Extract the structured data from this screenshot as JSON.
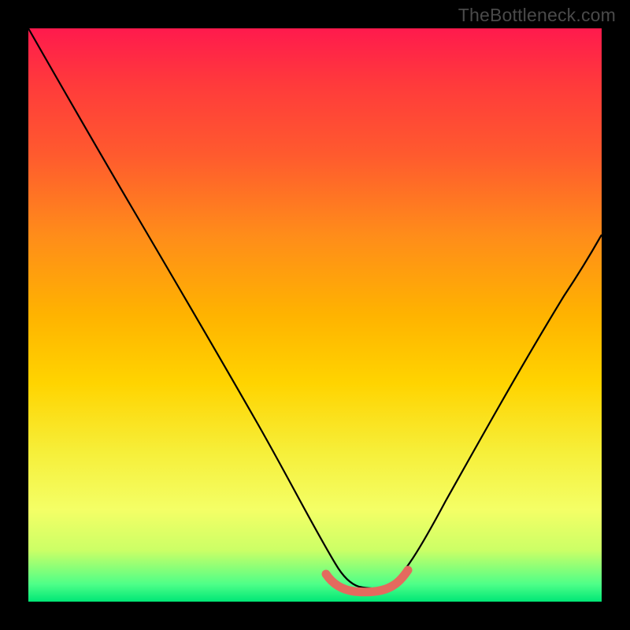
{
  "watermark": "TheBottleneck.com",
  "chart_data": {
    "type": "line",
    "title": "",
    "xlabel": "",
    "ylabel": "",
    "xlim": [
      0,
      100
    ],
    "ylim": [
      0,
      100
    ],
    "series": [
      {
        "name": "bottleneck-curve",
        "x": [
          0,
          6,
          12,
          18,
          24,
          30,
          36,
          42,
          48,
          52,
          55,
          58,
          61,
          64,
          70,
          76,
          82,
          88,
          94,
          100
        ],
        "values": [
          100,
          91,
          82,
          73,
          64,
          55,
          45,
          35,
          23,
          13,
          6,
          3,
          3,
          5,
          13,
          24,
          35,
          46,
          56,
          66
        ]
      },
      {
        "name": "sweet-spot-band",
        "x": [
          52,
          54,
          56,
          58,
          60,
          62,
          64
        ],
        "values": [
          5,
          3.5,
          2.8,
          2.5,
          2.8,
          3.5,
          5
        ]
      }
    ],
    "gradient_stops": [
      {
        "pos": 0.0,
        "color": "#ff1a4d"
      },
      {
        "pos": 0.5,
        "color": "#ffb300"
      },
      {
        "pos": 0.84,
        "color": "#f4ff66"
      },
      {
        "pos": 1.0,
        "color": "#00e676"
      }
    ],
    "curve_color": "#000000",
    "band_color": "#e46a5e"
  }
}
